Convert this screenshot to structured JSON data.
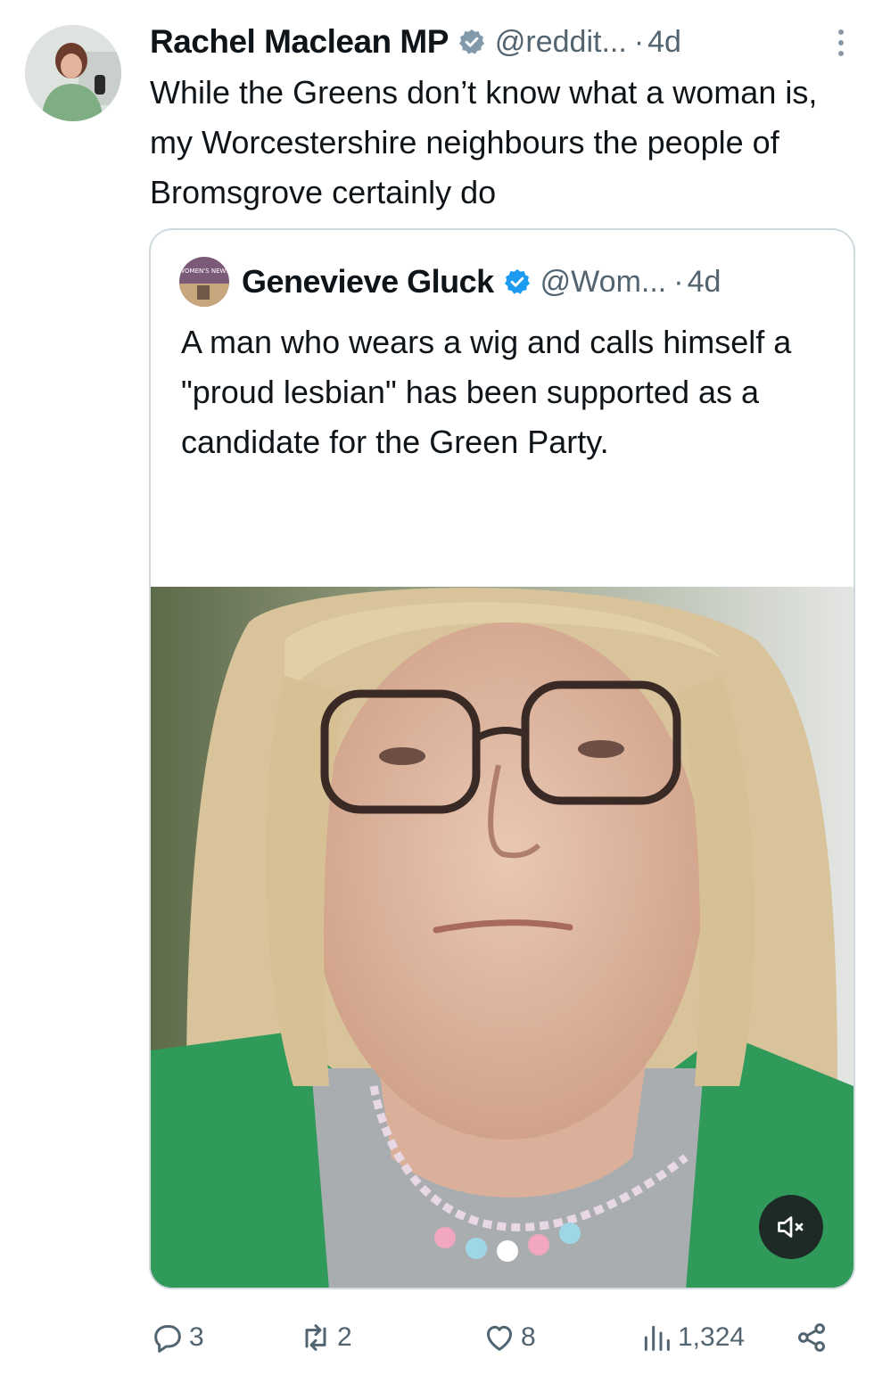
{
  "tweet": {
    "author_name": "Rachel Maclean MP",
    "handle": "@reddit...",
    "dot": "·",
    "time": "4d",
    "text": "While the Greens don’t know what a woman is, my Worcestershire neighbours the people of Bromsgrove certainly do"
  },
  "quote": {
    "author_name": "Genevieve Gluck",
    "handle": "@Wom...",
    "dot": "·",
    "time": "4d",
    "text": "A man who wears a wig and calls himself a \"proud lesbian\" has been supported as a candidate for the Green Party.",
    "ellipsis": "...",
    "avatar_text": "WOMEN'S NEWS"
  },
  "actions": {
    "replies": "3",
    "reposts": "2",
    "likes": "8",
    "views": "1,324"
  },
  "colors": {
    "verified": "#1d9bf0",
    "gray_badge": "#829aab",
    "text_secondary": "#536471",
    "border": "#cfd9de"
  },
  "icons": [
    "verified-gray-icon",
    "verified-blue-icon",
    "more-icon",
    "mute-icon",
    "reply-icon",
    "repost-icon",
    "like-icon",
    "views-icon",
    "share-icon"
  ]
}
